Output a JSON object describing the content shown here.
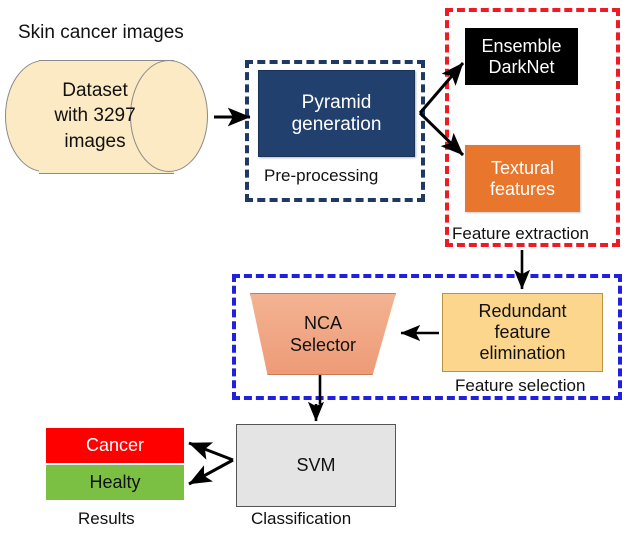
{
  "diagram": {
    "title_label": "Skin cancer images",
    "nodes": {
      "dataset": "Dataset\nwith 3297\nimages",
      "pyramid": "Pyramid\ngeneration",
      "darknet": "Ensemble\nDarkNet",
      "textural": "Textural\nfeatures",
      "redundant": "Redundant\nfeature\nelimination",
      "nca": "NCA\nSelector",
      "svm": "SVM",
      "cancer": "Cancer",
      "healty": "Healty"
    },
    "stage_labels": {
      "preprocessing": "Pre-processing",
      "feature_extraction": "Feature extraction",
      "feature_selection": "Feature selection",
      "results": "Results",
      "classification": "Classification"
    },
    "colors": {
      "dataset_fill": "#FCEAC4",
      "pyramid_fill": "#22406E",
      "darknet_fill": "#000000",
      "textural_fill": "#E8762C",
      "redundant_fill": "#FCD68C",
      "nca_fill": "#EE9B77",
      "svm_fill": "#E4E4E4",
      "cancer_fill": "#FF0000",
      "healty_fill": "#7BC043",
      "preprocessing_border": "#1F3864",
      "feature_extraction_border": "#ED1C24",
      "feature_selection_border": "#2020DD",
      "arrow": "#000000"
    },
    "edges": [
      {
        "from": "dataset",
        "to": "pyramid"
      },
      {
        "from": "pyramid",
        "to": "darknet"
      },
      {
        "from": "pyramid",
        "to": "textural"
      },
      {
        "from": "feature_extraction",
        "to": "redundant"
      },
      {
        "from": "redundant",
        "to": "nca"
      },
      {
        "from": "nca",
        "to": "svm"
      },
      {
        "from": "svm",
        "to": "cancer"
      },
      {
        "from": "svm",
        "to": "healty"
      }
    ]
  }
}
